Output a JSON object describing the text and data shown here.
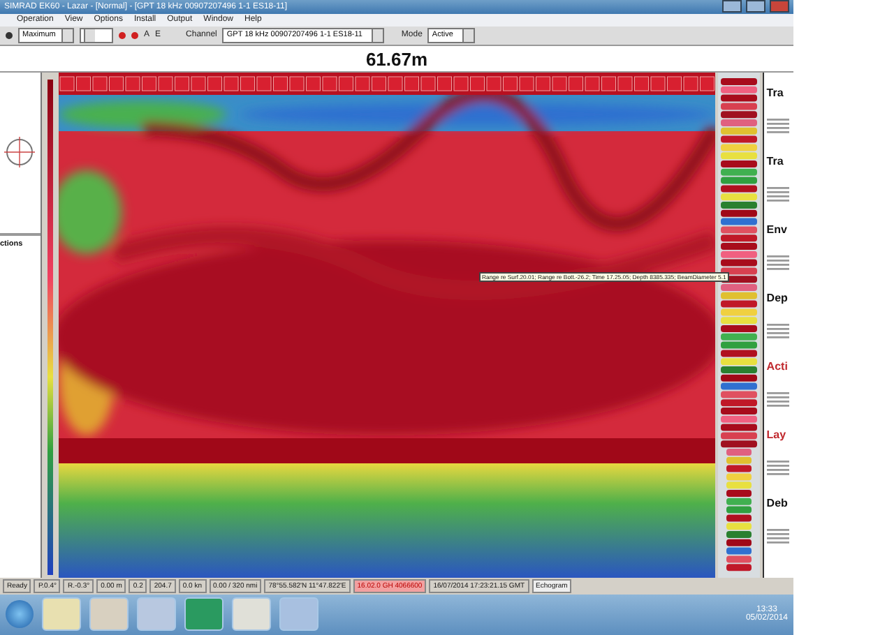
{
  "window": {
    "title": "SIMRAD EK60 - Lazar - [Normal] - [GPT 18 kHz 00907207496 1-1 ES18-11]"
  },
  "menu": [
    "Operation",
    "View",
    "Options",
    "Install",
    "Output",
    "Window",
    "Help"
  ],
  "toolbar": {
    "range_mode": "Maximum",
    "channel_label": "Channel",
    "channel": "GPT 18 kHz 00907207496 1-1 ES18-11",
    "mode_label": "Mode",
    "mode": "Active",
    "letters": [
      "A",
      "E"
    ]
  },
  "depth_header": "61.67m",
  "left_panel": {
    "label": "ctions"
  },
  "tooltip": "Range re Surf.20.01; Range re Bott.-26.2; Time 17.25.05; Depth 8385.335; BeamDiameter 5.1",
  "info_panel": {
    "headings": [
      {
        "text": "Tra",
        "kind": "dark"
      },
      {
        "text": "Tra",
        "kind": "dark"
      },
      {
        "text": "Env",
        "kind": "dark"
      },
      {
        "text": "Dep",
        "kind": "dark"
      },
      {
        "text": "Acti",
        "kind": "red"
      },
      {
        "text": "Lay",
        "kind": "red"
      },
      {
        "text": "Deb",
        "kind": "dark"
      }
    ]
  },
  "status_bar": [
    {
      "text": "Ready",
      "kind": "plain"
    },
    {
      "text": "P.0.4°",
      "kind": "plain"
    },
    {
      "text": "R.-0.3°",
      "kind": "plain"
    },
    {
      "text": "0.00 m",
      "kind": "plain"
    },
    {
      "text": "0.2",
      "kind": "plain"
    },
    {
      "text": "204.7",
      "kind": "plain"
    },
    {
      "text": "0.0 kn",
      "kind": "plain"
    },
    {
      "text": "0.00 / 320 nmi",
      "kind": "plain"
    },
    {
      "text": "78°55.582'N 11°47.822'E",
      "kind": "plain"
    },
    {
      "text": "16.02.0 GH 4066600",
      "kind": "alert"
    },
    {
      "text": "16/07/2014 17:23:21.15 GMT",
      "kind": "plain"
    },
    {
      "text": "Echogram",
      "kind": "button"
    }
  ],
  "taskbar": {
    "time": "13:33",
    "date": "05/02/2014"
  }
}
